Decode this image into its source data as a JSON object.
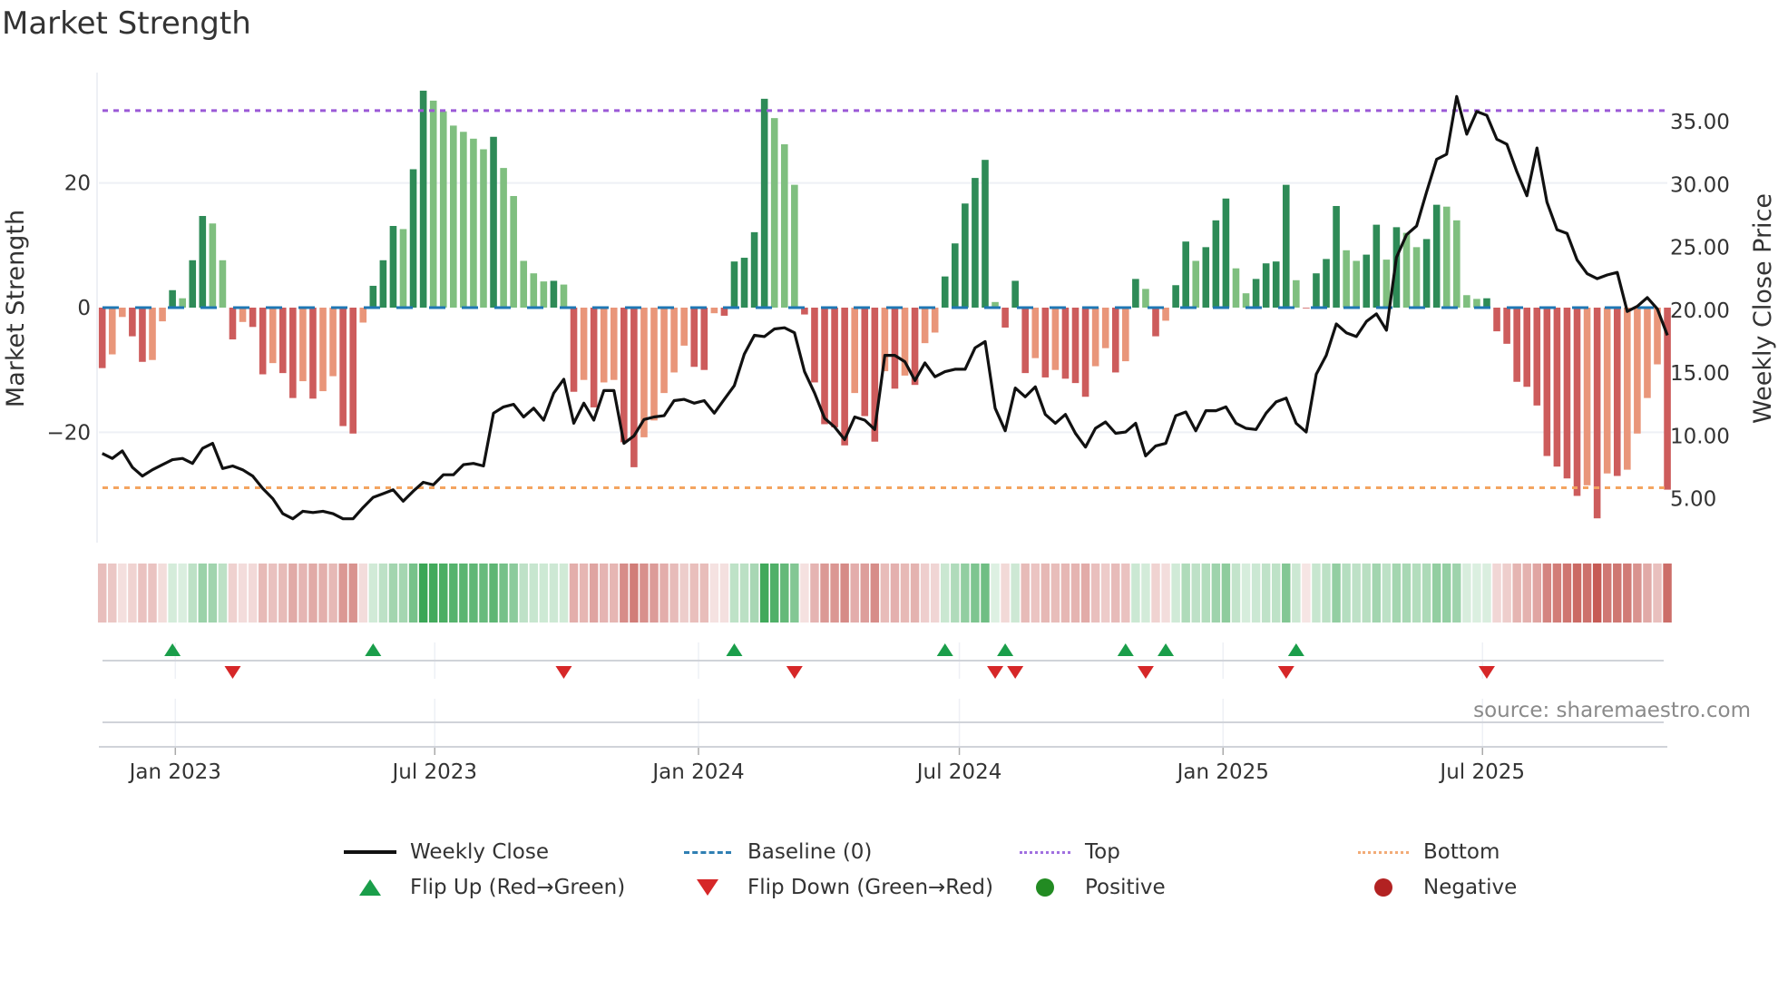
{
  "title": "Market Strength",
  "source": "source: sharemaestro.com",
  "legend": {
    "weekly_close": "Weekly Close",
    "baseline": "Baseline (0)",
    "top": "Top",
    "bottom": "Bottom",
    "flip_up": "Flip Up (Red→Green)",
    "flip_down": "Flip Down (Green→Red)",
    "positive": "Positive",
    "negative": "Negative"
  },
  "colors": {
    "strong_positive": "#2e8b57",
    "weak_positive": "#7fbf7f",
    "strong_negative": "#cd5c5c",
    "weak_negative": "#e9967a",
    "baseline": "#1f77b4",
    "top": "#9b59d6",
    "bottom": "#f4a460",
    "price_line": "#111111",
    "flip_up": "#1a9e4a",
    "flip_down": "#d62728",
    "positive": "#228b22",
    "negative": "#b22222"
  },
  "chart_data": {
    "type": "bar",
    "title": "Market Strength",
    "ylabel": "Market Strength",
    "y2label": "Weekly Close Price",
    "ylim": [
      -37.7,
      37.7
    ],
    "y2lim": [
      1.5,
      38.9
    ],
    "yticks": [
      {
        "v": -20,
        "label": "−20"
      },
      {
        "v": 0,
        "label": "0"
      },
      {
        "v": 20,
        "label": "20"
      }
    ],
    "y2ticks": [
      {
        "v": 5,
        "label": "5.00"
      },
      {
        "v": 10,
        "label": "10.00"
      },
      {
        "v": 15,
        "label": "15.00"
      },
      {
        "v": 20,
        "label": "20.00"
      },
      {
        "v": 25,
        "label": "25.00"
      },
      {
        "v": 30,
        "label": "30.00"
      },
      {
        "v": 35,
        "label": "35.00"
      }
    ],
    "xticks": [
      {
        "date": "2023-01-01",
        "label": "Jan 2023"
      },
      {
        "date": "2023-07-01",
        "label": "Jul 2023"
      },
      {
        "date": "2024-01-01",
        "label": "Jan 2024"
      },
      {
        "date": "2024-07-01",
        "label": "Jul 2024"
      },
      {
        "date": "2025-01-01",
        "label": "Jan 2025"
      },
      {
        "date": "2025-07-01",
        "label": "Jul 2025"
      }
    ],
    "grid": true,
    "legend_position": "bottom",
    "top_level": 31.6,
    "bottom_level": -28.9,
    "baseline": 0,
    "dates": [
      "2022-11-11",
      "2022-11-18",
      "2022-11-25",
      "2022-12-02",
      "2022-12-09",
      "2022-12-16",
      "2022-12-23",
      "2022-12-30",
      "2023-01-06",
      "2023-01-13",
      "2023-01-20",
      "2023-01-27",
      "2023-02-03",
      "2023-02-10",
      "2023-02-17",
      "2023-02-24",
      "2023-03-03",
      "2023-03-10",
      "2023-03-17",
      "2023-03-24",
      "2023-03-31",
      "2023-04-07",
      "2023-04-14",
      "2023-04-21",
      "2023-04-28",
      "2023-05-05",
      "2023-05-12",
      "2023-05-19",
      "2023-05-26",
      "2023-06-02",
      "2023-06-09",
      "2023-06-16",
      "2023-06-23",
      "2023-06-30",
      "2023-07-07",
      "2023-07-14",
      "2023-07-21",
      "2023-07-28",
      "2023-08-04",
      "2023-08-11",
      "2023-08-18",
      "2023-08-25",
      "2023-09-01",
      "2023-09-08",
      "2023-09-15",
      "2023-09-22",
      "2023-09-29",
      "2023-10-06",
      "2023-10-13",
      "2023-10-20",
      "2023-10-27",
      "2023-11-03",
      "2023-11-10",
      "2023-11-17",
      "2023-11-24",
      "2023-12-01",
      "2023-12-08",
      "2023-12-15",
      "2023-12-22",
      "2023-12-29",
      "2024-01-05",
      "2024-01-12",
      "2024-01-19",
      "2024-01-26",
      "2024-02-02",
      "2024-02-09",
      "2024-02-16",
      "2024-02-23",
      "2024-03-01",
      "2024-03-08",
      "2024-03-15",
      "2024-03-22",
      "2024-03-29",
      "2024-04-05",
      "2024-04-12",
      "2024-04-19",
      "2024-04-26",
      "2024-05-03",
      "2024-05-10",
      "2024-05-17",
      "2024-05-24",
      "2024-05-31",
      "2024-06-07",
      "2024-06-14",
      "2024-06-21",
      "2024-06-28",
      "2024-07-05",
      "2024-07-12",
      "2024-07-19",
      "2024-07-26",
      "2024-08-02",
      "2024-08-09",
      "2024-08-16",
      "2024-08-23",
      "2024-08-30",
      "2024-09-06",
      "2024-09-13",
      "2024-09-20",
      "2024-09-27",
      "2024-10-04",
      "2024-10-11",
      "2024-10-18",
      "2024-10-25",
      "2024-11-01",
      "2024-11-08",
      "2024-11-15",
      "2024-11-22",
      "2024-11-29",
      "2024-12-06",
      "2024-12-13",
      "2024-12-20",
      "2024-12-27",
      "2025-01-03",
      "2025-01-10",
      "2025-01-17",
      "2025-01-24",
      "2025-01-31",
      "2025-02-07",
      "2025-02-14",
      "2025-02-21",
      "2025-02-28",
      "2025-03-07",
      "2025-03-14",
      "2025-03-21",
      "2025-03-28",
      "2025-04-04",
      "2025-04-11",
      "2025-04-18",
      "2025-04-25",
      "2025-05-02",
      "2025-05-09",
      "2025-05-16",
      "2025-05-23",
      "2025-05-30",
      "2025-06-06",
      "2025-06-13",
      "2025-06-20",
      "2025-06-27",
      "2025-07-04",
      "2025-07-11",
      "2025-07-18",
      "2025-07-25",
      "2025-08-01",
      "2025-08-08",
      "2025-08-15",
      "2025-08-22",
      "2025-08-29",
      "2025-09-05",
      "2025-09-12",
      "2025-09-19",
      "2025-09-26",
      "2025-10-03",
      "2025-10-10",
      "2025-10-17",
      "2025-10-24",
      "2025-10-31",
      "2025-11-07"
    ],
    "series": [
      {
        "name": "Market Strength",
        "axis": "left",
        "type": "bar",
        "values": [
          -9.7,
          -7.5,
          -1.5,
          -4.6,
          -8.7,
          -8.4,
          -2.2,
          2.8,
          1.5,
          7.6,
          14.7,
          13.5,
          7.6,
          -5.1,
          -2.3,
          -3.1,
          -10.7,
          -8.9,
          -10.5,
          -14.5,
          -11.8,
          -14.6,
          -13.4,
          -11.0,
          -19.0,
          -20.2,
          -2.4,
          3.5,
          7.6,
          13.1,
          12.6,
          22.2,
          34.8,
          33.2,
          31.5,
          29.2,
          28.2,
          27.1,
          25.4,
          27.4,
          22.4,
          17.9,
          7.5,
          5.5,
          4.2,
          4.3,
          3.7,
          -13.5,
          -11.6,
          -16.0,
          -12.0,
          -11.6,
          -21.6,
          -25.6,
          -20.8,
          -18.1,
          -13.7,
          -10.4,
          -6.1,
          -9.5,
          -10.0,
          -0.9,
          -1.3,
          7.4,
          8.0,
          12.1,
          33.5,
          30.4,
          26.2,
          19.7,
          -1.1,
          -12.0,
          -18.7,
          -19.2,
          -22.1,
          -13.7,
          -17.4,
          -21.5,
          -10.2,
          -13.0,
          -10.9,
          -12.4,
          -5.7,
          -4.0,
          5.0,
          10.3,
          16.7,
          20.8,
          23.7,
          0.9,
          -3.2,
          4.3,
          -10.5,
          -8.1,
          -11.2,
          -10.0,
          -11.4,
          -12.1,
          -14.3,
          -9.4,
          -6.5,
          -10.4,
          -8.6,
          4.6,
          3.0,
          -4.6,
          -2.1,
          3.6,
          10.6,
          7.5,
          9.7,
          14.0,
          17.5,
          6.3,
          2.3,
          4.6,
          7.1,
          7.4,
          19.7,
          4.4,
          -0.1,
          5.5,
          7.8,
          16.3,
          9.2,
          7.5,
          8.5,
          13.3,
          7.7,
          12.9,
          12.0,
          9.7,
          11.0,
          16.5,
          16.2,
          14.0,
          2.0,
          1.4,
          1.5,
          -3.8,
          -5.8,
          -11.9,
          -12.7,
          -15.7,
          -23.8,
          -25.5,
          -27.4,
          -30.2,
          -28.5,
          -33.8,
          -26.6,
          -27.0,
          -26.0,
          -20.2,
          -14.5,
          -9.1,
          -29.2
        ]
      },
      {
        "name": "Weekly Close",
        "axis": "right",
        "type": "line",
        "values": [
          8.6,
          8.2,
          8.8,
          7.5,
          6.8,
          7.3,
          7.7,
          8.1,
          8.2,
          7.8,
          9.0,
          9.4,
          7.4,
          7.6,
          7.3,
          6.8,
          5.8,
          5.0,
          3.8,
          3.4,
          4.0,
          3.9,
          4.0,
          3.8,
          3.4,
          3.4,
          4.3,
          5.1,
          5.4,
          5.7,
          4.8,
          5.6,
          6.3,
          6.1,
          6.9,
          6.9,
          7.7,
          7.8,
          7.6,
          11.8,
          12.3,
          12.5,
          11.5,
          12.2,
          11.25,
          13.4,
          14.5,
          11.0,
          12.6,
          11.25,
          13.6,
          13.6,
          9.4,
          10.0,
          11.3,
          11.5,
          11.6,
          12.8,
          12.9,
          12.6,
          12.8,
          11.8,
          12.9,
          14.0,
          16.5,
          18.0,
          17.9,
          18.5,
          18.6,
          18.2,
          15.1,
          13.4,
          11.4,
          10.7,
          9.7,
          11.5,
          11.25,
          10.5,
          16.4,
          16.4,
          15.9,
          14.4,
          15.8,
          14.7,
          15.1,
          15.3,
          15.3,
          17.0,
          17.5,
          12.2,
          10.4,
          13.8,
          13.1,
          13.9,
          11.7,
          11.0,
          11.7,
          10.2,
          9.1,
          10.6,
          11.1,
          10.2,
          10.3,
          11.0,
          8.4,
          9.2,
          9.4,
          11.6,
          11.9,
          10.4,
          12.0,
          12.0,
          12.3,
          11.0,
          10.6,
          10.5,
          11.8,
          12.7,
          13.0,
          11.0,
          10.3,
          14.9,
          16.4,
          18.9,
          18.2,
          17.9,
          19.1,
          19.7,
          18.4,
          24.2,
          26.0,
          26.7,
          29.4,
          32.0,
          32.4,
          37.0,
          34.0,
          35.8,
          35.5,
          33.6,
          33.2,
          31.0,
          29.1,
          32.9,
          28.6,
          26.4,
          26.1,
          24.0,
          22.9,
          22.5,
          22.8,
          23.0,
          19.9,
          20.3,
          21.0,
          20.1,
          18.0
        ]
      }
    ],
    "flip_up_dates": [
      "2022-12-30",
      "2023-05-19",
      "2024-01-26",
      "2024-06-21",
      "2024-08-02",
      "2024-10-25",
      "2024-11-22",
      "2025-02-21"
    ],
    "flip_down_dates": [
      "2023-02-10",
      "2023-09-29",
      "2024-03-08",
      "2024-07-26",
      "2024-08-09",
      "2024-11-08",
      "2025-02-14",
      "2025-07-04"
    ]
  }
}
